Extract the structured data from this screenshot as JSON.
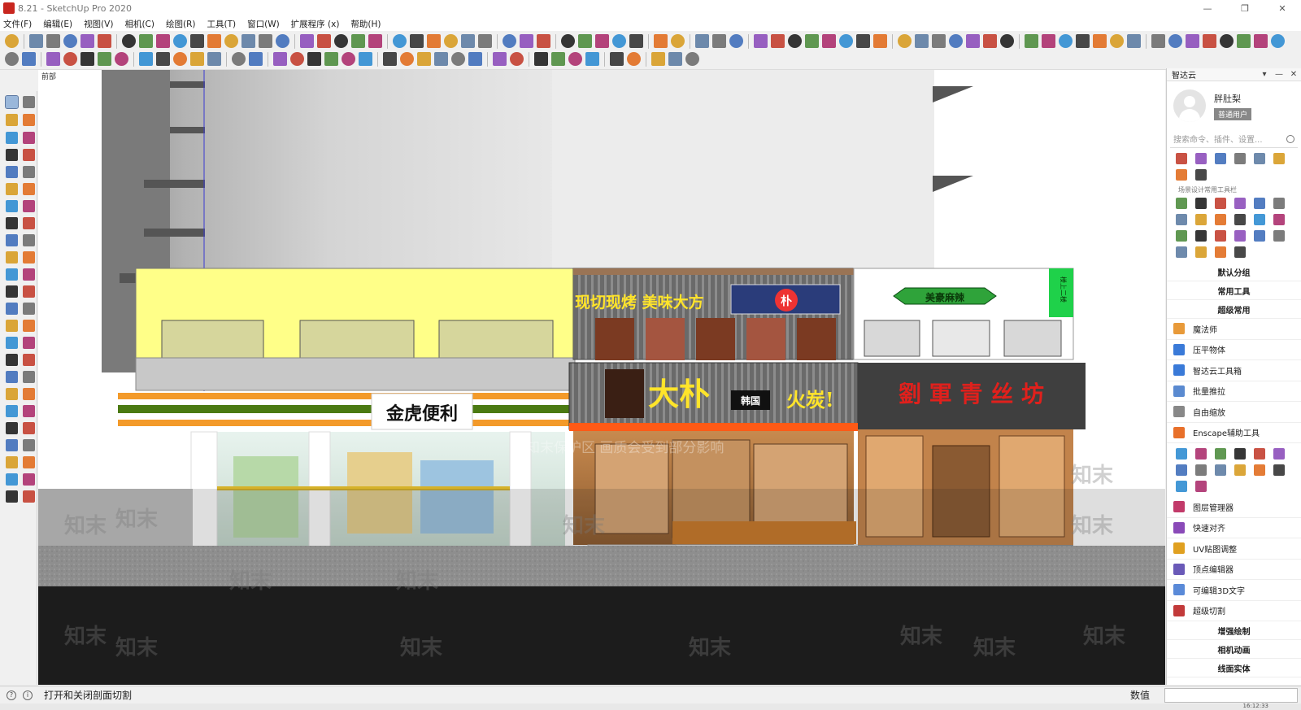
{
  "window": {
    "title": "8.21 - SketchUp Pro 2020",
    "controls": [
      "—",
      "❐",
      "✕"
    ]
  },
  "menu": [
    "文件(F)",
    "编辑(E)",
    "视图(V)",
    "相机(C)",
    "绘图(R)",
    "工具(T)",
    "窗口(W)",
    "扩展程序 (x)",
    "帮助(H)"
  ],
  "viewport": {
    "scene_label": "前部",
    "signs": {
      "convenience": "金虎便利",
      "bbq_banner": "现切现烤 美味大方",
      "dapu_name": "大朴",
      "dapu_sub": "韩国",
      "dapu_fire": "火炭!",
      "dapu_board": "朴",
      "liujun": "劉 軍   青 丝 坊",
      "green_sign": "美豪麻辣",
      "green_vertical": "楼上二楼"
    },
    "watermarks": [
      "知末",
      "知末",
      "知末",
      "知末",
      "知末",
      "知末",
      "知末",
      "知末",
      "知末",
      "知末",
      "知末",
      "知末",
      "知末",
      "知末"
    ],
    "watermark_text": "知末保护区  画质会受到部分影响"
  },
  "right_panel": {
    "title": "智达云",
    "header_controls": [
      "▾",
      "—",
      "✕"
    ],
    "user_name": "胖肚梨",
    "user_badge": "普通用户",
    "search_placeholder": "搜索命令、插件、设置...",
    "toolbar_caption": "场景设计常用工具栏",
    "sections": {
      "default_group": "默认分组",
      "common_tools": "常用工具",
      "super_common": "超级常用",
      "enhanced_draw": "增强绘制",
      "camera_anim": "相机动画",
      "line_solid": "线面实体"
    },
    "items1": [
      "魔法师",
      "压平物体",
      "智达云工具箱",
      "批量推拉",
      "自由缩放",
      "Enscape辅助工具"
    ],
    "items2": [
      "图层管理器",
      "快速对齐",
      "UV贴图调整",
      "顶点编辑器",
      "可编辑3D文字",
      "超级切割"
    ]
  },
  "status": {
    "text": "打开和关闭剖面切割",
    "measure_label": "数值",
    "clock": "16:12:33",
    "icons": [
      "?",
      "i"
    ]
  },
  "colors": {
    "accent_green": "#2fa33a",
    "yellow_facade": "#ffff88",
    "liujun_red": "#e0201c",
    "dapu_yellow": "#ffe42a"
  }
}
